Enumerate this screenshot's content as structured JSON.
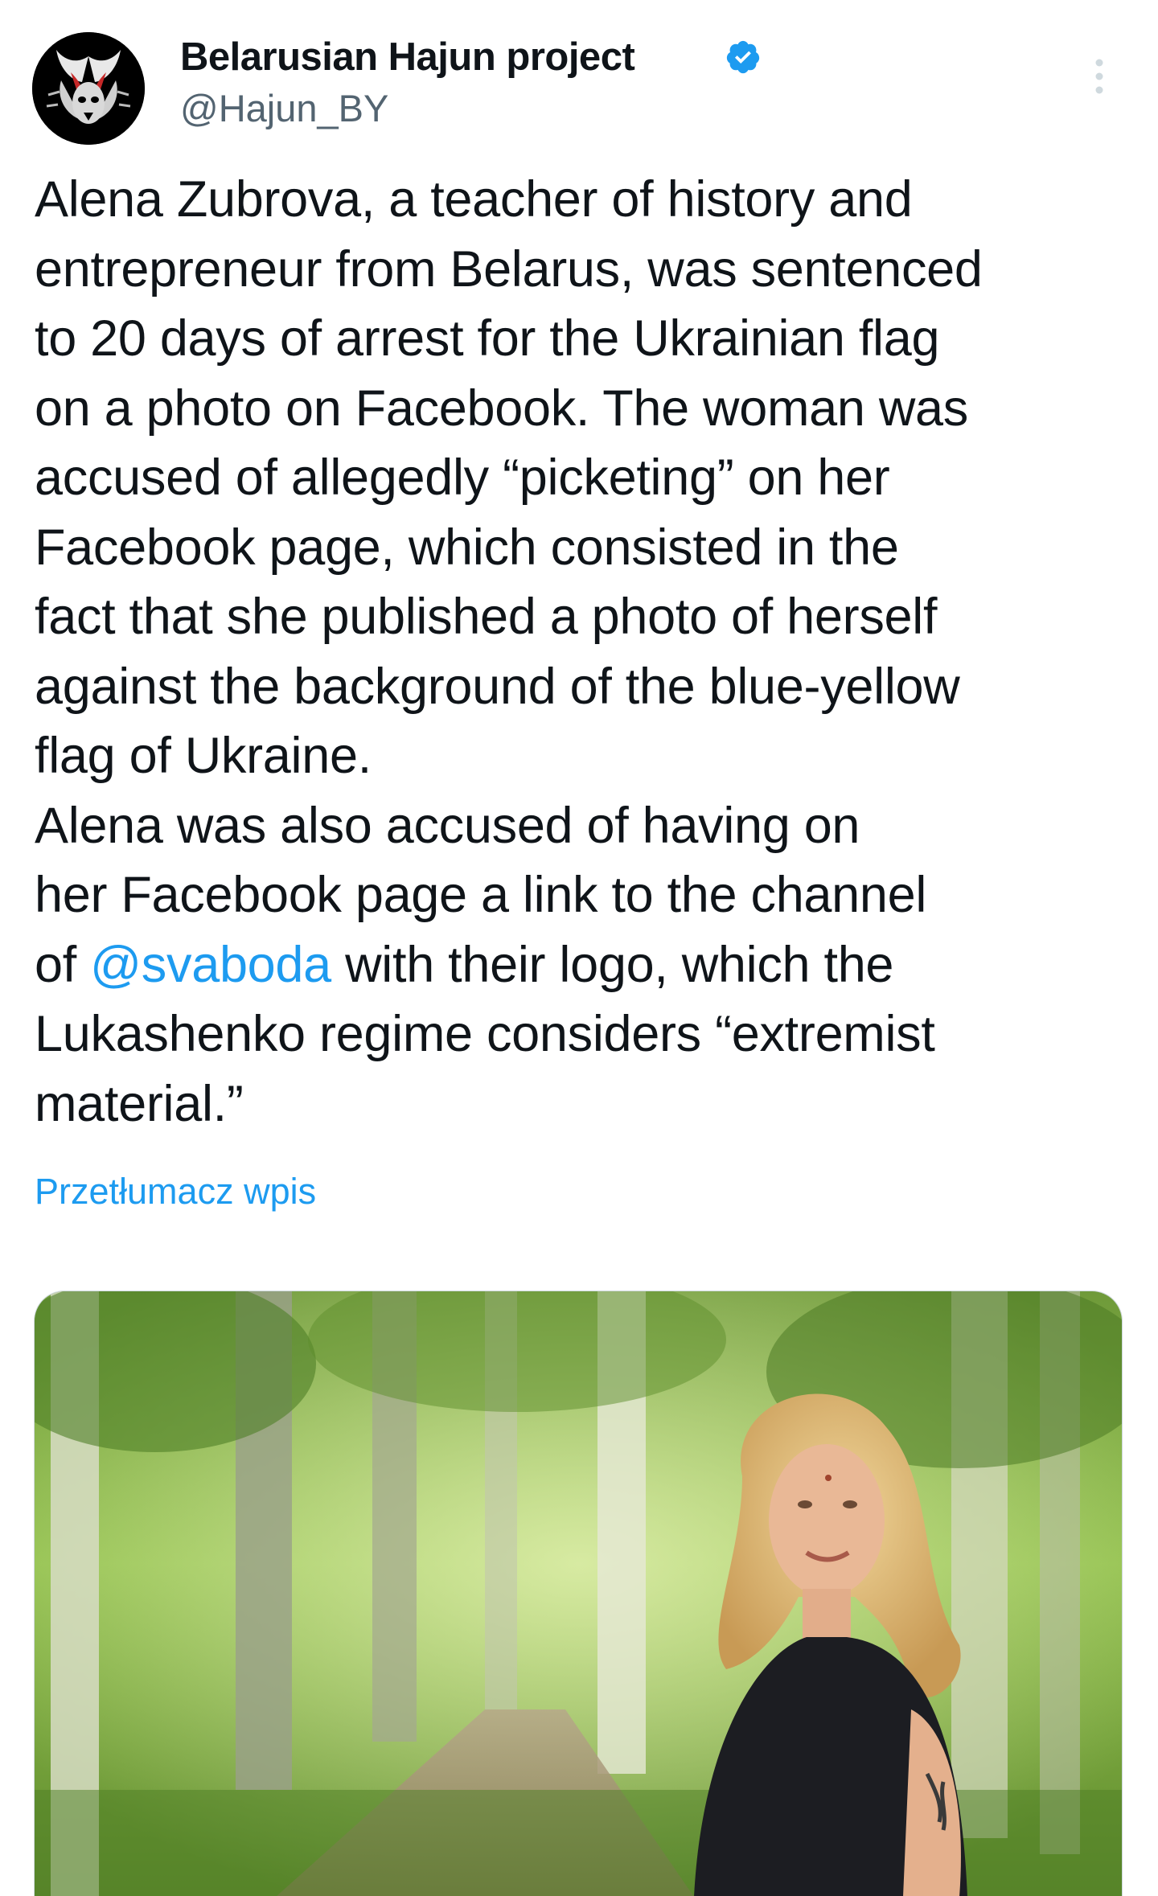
{
  "author": {
    "name": "Belarusian Hajun project",
    "handle": "@Hajun_BY",
    "verified": true,
    "avatar_icon": "hajun-logo-icon"
  },
  "tweet": {
    "lines": [
      "Alena Zubrova, a teacher of history and",
      "entrepreneur from Belarus, was sentenced",
      "to 20 days of arrest for the Ukrainian flag",
      "on a photo on Facebook. The woman was",
      "accused of allegedly “picketing” on her",
      "Facebook page, which consisted in the",
      "fact that she published a photo of herself",
      "against the background of the blue-yellow",
      "flag of Ukraine.",
      "Alena was also accused of having on",
      "her Facebook page a link to the channel"
    ],
    "mention_line": {
      "before": "of ",
      "mention": "@svaboda",
      "after": " with their logo, which the"
    },
    "lines_after": [
      "Lukashenko regime considers “extremist",
      "material.”"
    ]
  },
  "translate_label": "Przetłumacz wpis",
  "colors": {
    "link": "#1d9bf0",
    "verified_badge": "#1d9bf0",
    "secondary_text": "#536471",
    "text": "#0f1419"
  }
}
